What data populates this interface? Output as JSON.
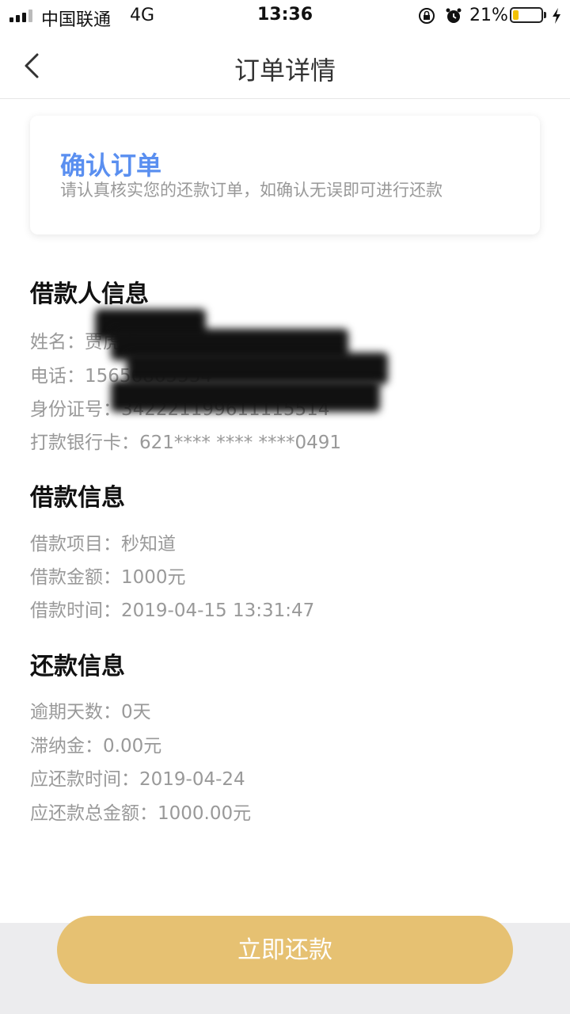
{
  "status_bar": {
    "carrier": "中国联通",
    "network": "4G",
    "time": "13:36",
    "battery_percent": "21%",
    "battery_level": 0.21,
    "icons": [
      "signal-icon",
      "lock-rotation-icon",
      "alarm-icon",
      "battery-icon",
      "charging-bolt-icon"
    ]
  },
  "nav": {
    "title": "订单详情",
    "back_icon": "chevron-left-icon"
  },
  "confirm_card": {
    "title": "确认订单",
    "description": "请认真核实您的还款订单，如确认无误即可进行还款"
  },
  "borrower_info": {
    "title": "借款人信息",
    "lines": [
      "姓名：贾虎虎",
      "电话：15656865534",
      "身份证号：342221199611115514",
      "打款银行卡：621**** **** ****0491"
    ]
  },
  "loan_info": {
    "title": "借款信息",
    "lines": [
      "借款项目：秒知道",
      "借款金额：1000元",
      "借款时间：2019-04-15 13:31:47"
    ]
  },
  "repay_info": {
    "title": "还款信息",
    "lines": [
      "逾期天数：0天",
      "滞纳金：0.00元",
      "应还款时间：2019-04-24",
      "应还款总金额：1000.00元"
    ]
  },
  "actions": {
    "repay_label": "立即还款"
  },
  "colors": {
    "accent_blue": "#5a8ff0",
    "button_gold": "#e6c172",
    "battery_yellow": "#f2c200"
  }
}
